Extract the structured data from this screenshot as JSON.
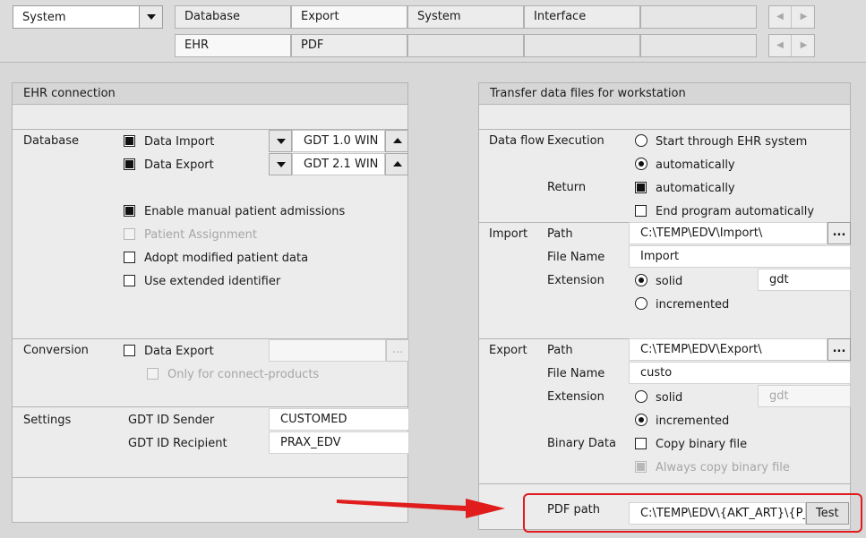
{
  "top": {
    "system_select": "System",
    "tabs_row1": [
      "Database",
      "Export",
      "System",
      "Interface"
    ],
    "tabs_row2": [
      "EHR",
      "PDF"
    ]
  },
  "ehr": {
    "title": "EHR connection",
    "database_label": "Database",
    "data_import_label": "Data Import",
    "data_import_format": "GDT 1.0 WIN",
    "data_export_label": "Data Export",
    "data_export_format": "GDT 2.1 WIN",
    "enable_manual": "Enable manual patient admissions",
    "patient_assignment": "Patient Assignment",
    "adopt_modified": "Adopt modified patient data",
    "use_extended": "Use extended identifier",
    "conversion_label": "Conversion",
    "conversion_export_label": "Data Export",
    "only_connect": "Only for connect-products",
    "settings_label": "Settings",
    "gdt_sender_label": "GDT ID Sender",
    "gdt_sender_value": "CUSTOMED",
    "gdt_recipient_label": "GDT ID Recipient",
    "gdt_recipient_value": "PRAX_EDV"
  },
  "transfer": {
    "title": "Transfer data files for workstation",
    "data_flow_label": "Data flow",
    "execution_label": "Execution",
    "start_through": "Start through EHR system",
    "automatically": "automatically",
    "return_label": "Return",
    "return_automatically": "automatically",
    "end_program": "End program automatically",
    "import_label": "Import",
    "path_label": "Path",
    "import_path": "C:\\TEMP\\EDV\\Import\\",
    "file_name_label": "File Name",
    "import_file_name": "Import",
    "extension_label": "Extension",
    "solid": "solid",
    "import_extension": "gdt",
    "incremented": "incremented",
    "export_label": "Export",
    "export_path": "C:\\TEMP\\EDV\\Export\\",
    "export_file_name": "custo",
    "export_solid": "solid",
    "export_extension": "gdt",
    "export_incremented": "incremented",
    "binary_data_label": "Binary Data",
    "copy_binary": "Copy binary file",
    "always_copy_binary": "Always copy binary file",
    "pdf_path_label": "PDF path",
    "pdf_path_value": "C:\\TEMP\\EDV\\{AKT_ART}\\{P_",
    "test_label": "Test",
    "dots": "..."
  },
  "colors": {
    "highlight": "#e01c1c"
  }
}
